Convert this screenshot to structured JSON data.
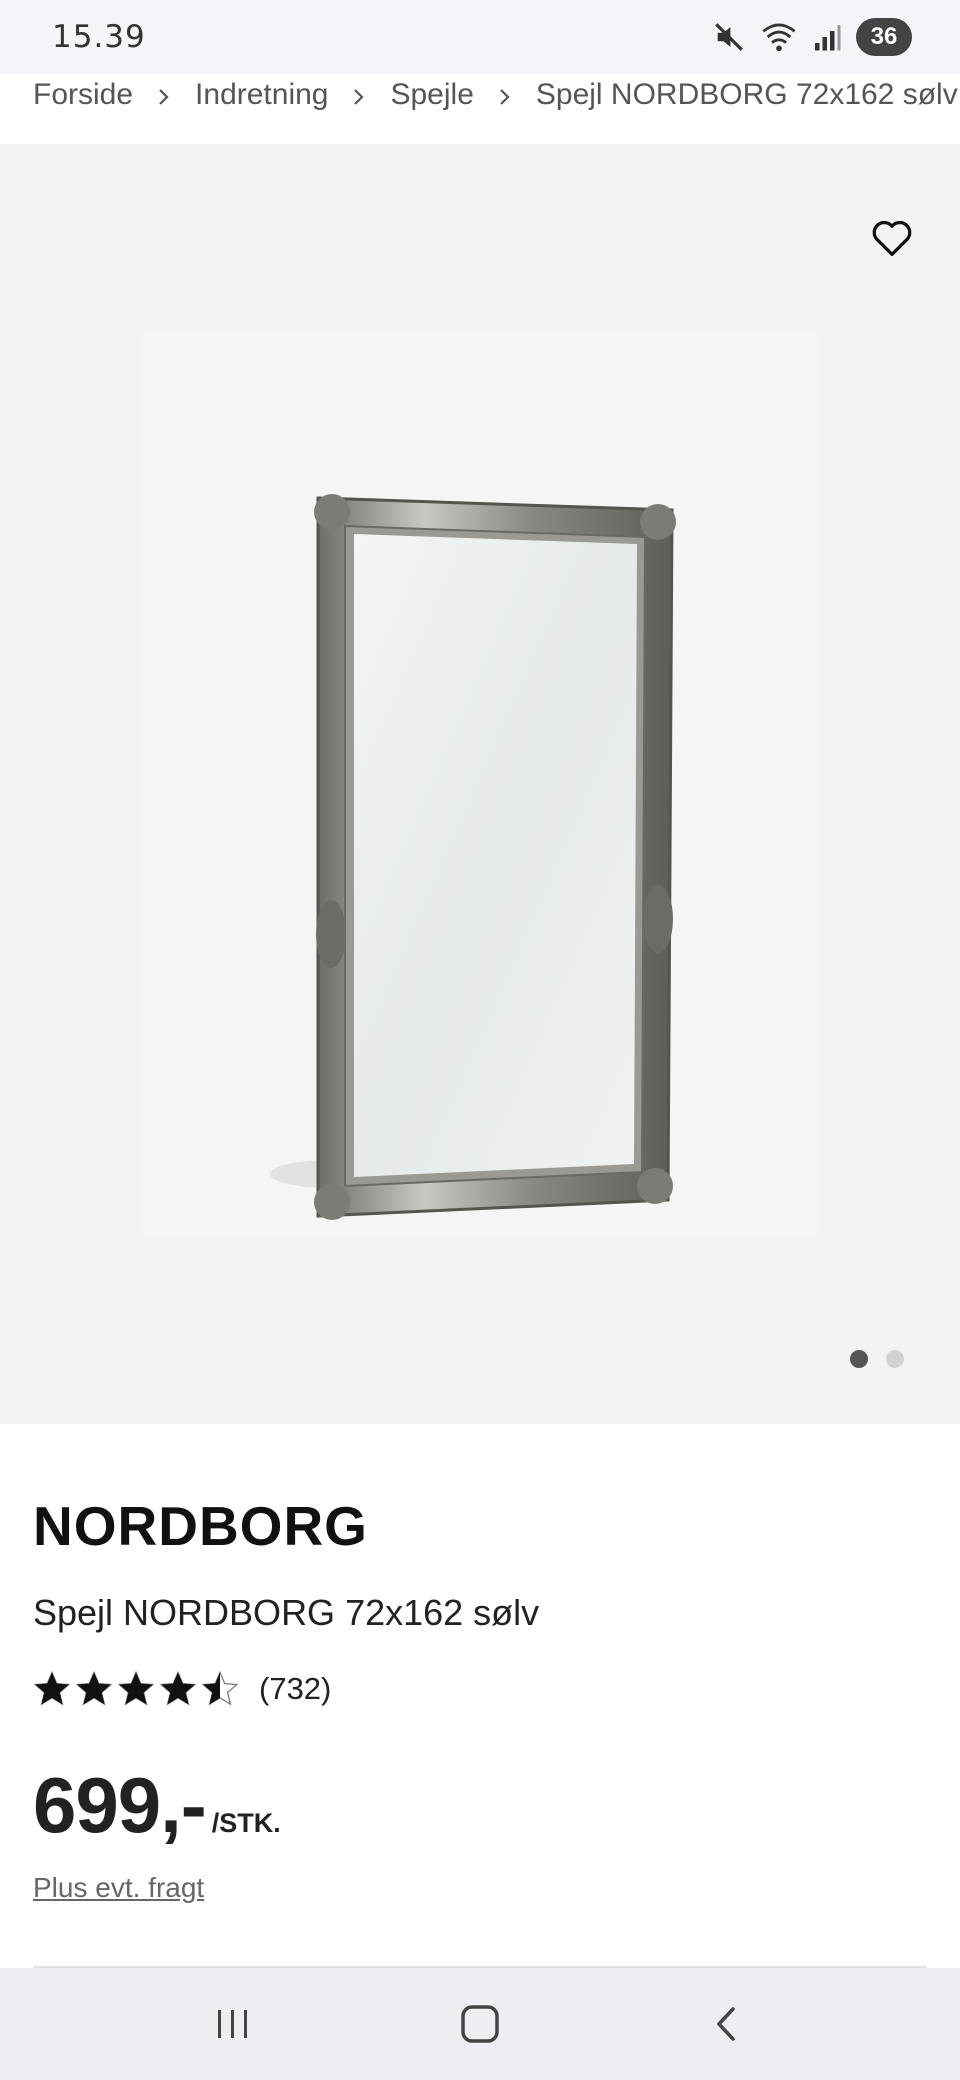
{
  "status_bar": {
    "time": "15.39",
    "battery": "36"
  },
  "breadcrumb": {
    "items": [
      "Forside",
      "Indretning",
      "Spejle",
      "Spejl NORDBORG 72x162 sølv"
    ]
  },
  "gallery": {
    "image_count": 2,
    "active_index": 0
  },
  "product": {
    "brand": "NORDBORG",
    "name": "Spejl NORDBORG 72x162 sølv",
    "rating": 4.5,
    "review_count": "(732)",
    "price": "699,-",
    "unit": "/STK.",
    "shipping_link": "Plus evt. fragt"
  },
  "icons": {
    "status": [
      "mute-icon",
      "wifi-icon",
      "signal-icon"
    ],
    "favorite": "heart-icon",
    "nav": [
      "recent-apps-icon",
      "home-icon",
      "back-icon"
    ]
  },
  "colors": {
    "gallery_bg": "#f3f3f3",
    "star": "#111111",
    "dot_active": "#555555",
    "dot_inactive": "#d2d2d2"
  }
}
